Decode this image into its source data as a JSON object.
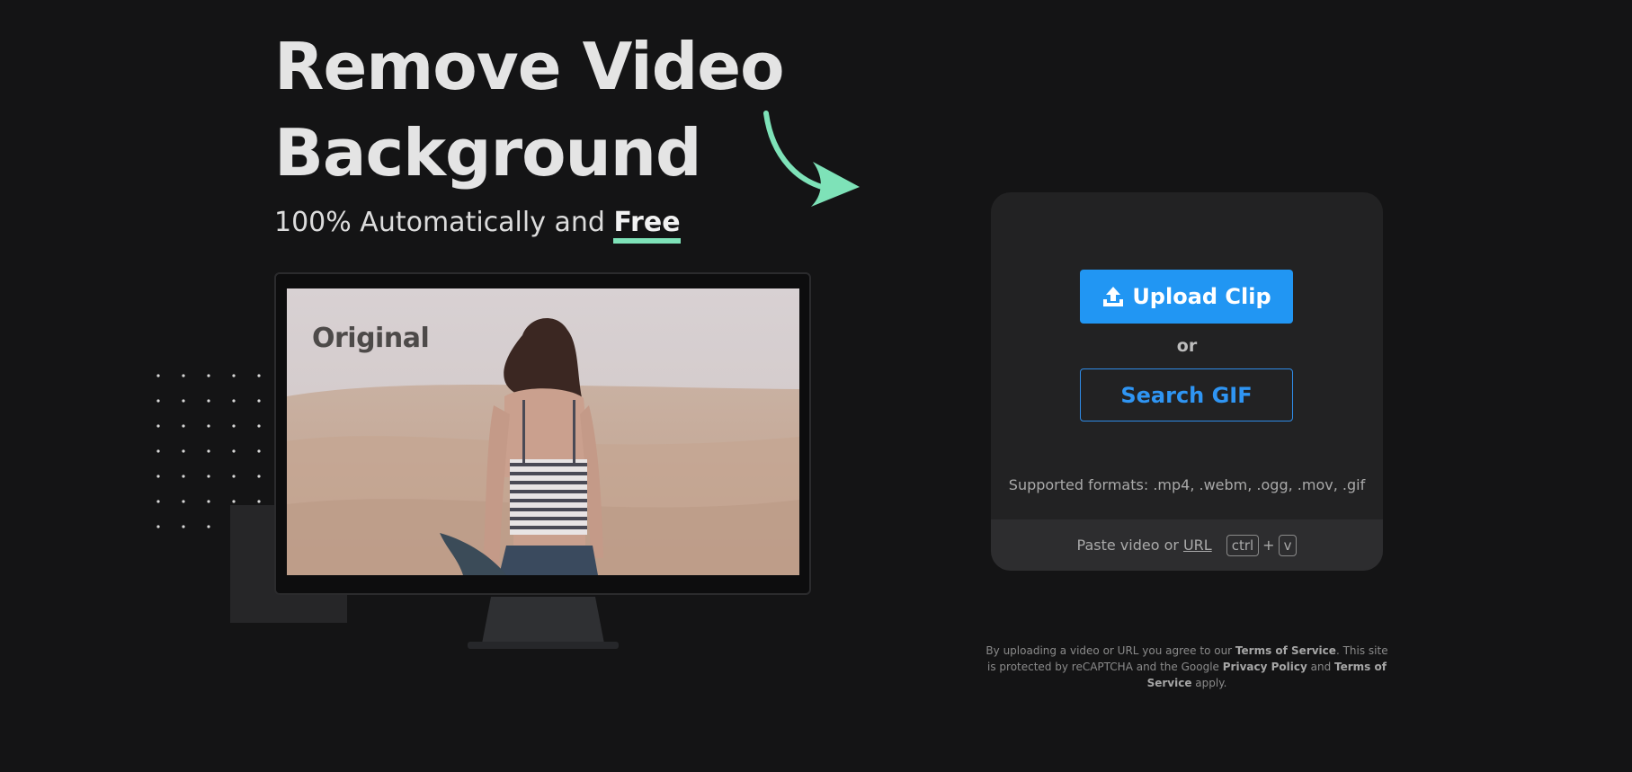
{
  "hero": {
    "title_line1": "Remove Video",
    "title_line2": "Background",
    "subtitle_prefix": "100% Automatically and ",
    "subtitle_highlight": "Free"
  },
  "preview": {
    "label": "Original"
  },
  "upload": {
    "upload_label": "Upload Clip",
    "upload_icon": "upload-icon",
    "or_label": "or",
    "gif_label": "Search GIF",
    "formats": "Supported formats: .mp4, .webm, .ogg, .mov, .gif",
    "paste_prefix": "Paste video or",
    "paste_link": "URL",
    "key1": "ctrl",
    "plus": "+",
    "key2": "v"
  },
  "legal": {
    "part1": "By uploading a video or URL you agree to our ",
    "tos1": "Terms of Service",
    "part2": ". This site is protected by reCAPTCHA and the Google ",
    "privacy": "Privacy Policy",
    "part3": " and ",
    "tos2": "Terms of Service",
    "part4": " apply."
  },
  "colors": {
    "background": "#141415",
    "accent_blue": "#2196f3",
    "accent_green": "#7ee2b8",
    "card": "#222223"
  }
}
